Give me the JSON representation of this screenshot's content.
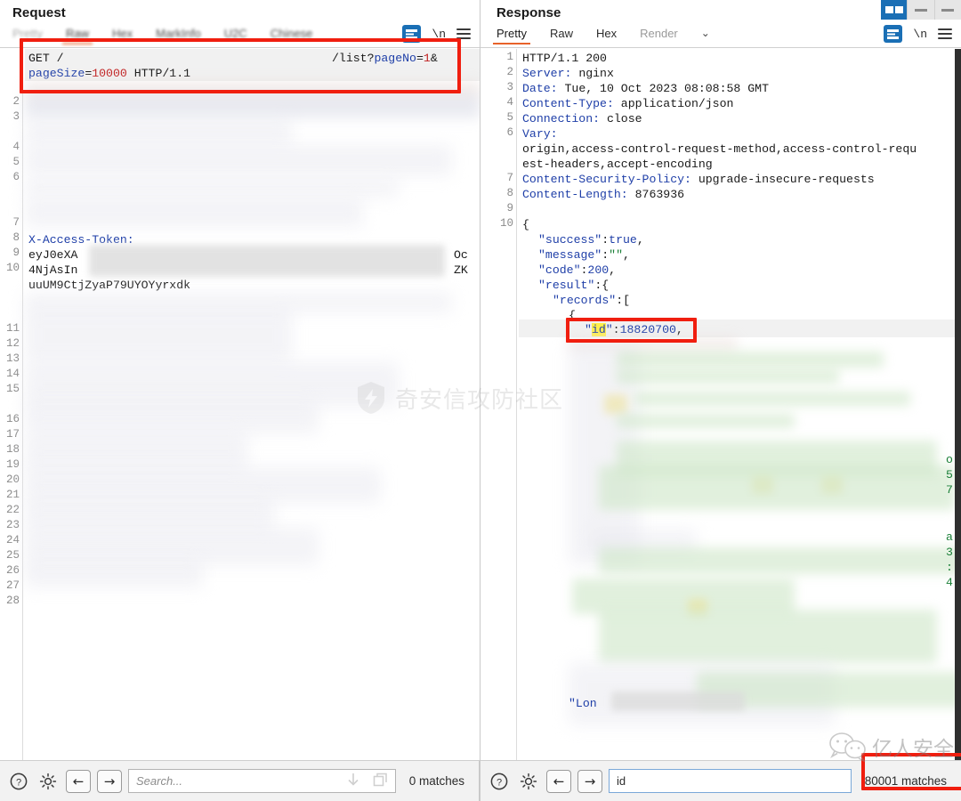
{
  "window": {
    "controls": [
      {
        "name": "restore",
        "state": "active"
      },
      {
        "name": "minimize",
        "state": "normal"
      },
      {
        "name": "maximize",
        "state": "normal"
      }
    ]
  },
  "watermarks": {
    "center": "奇安信攻防社区",
    "bottom_right": "亿人安全"
  },
  "request": {
    "title": "Request",
    "tabs": [
      {
        "label": "Pretty",
        "active": false,
        "muted": true
      },
      {
        "label": "Raw",
        "active": true,
        "muted": false
      },
      {
        "label": "Hex",
        "active": false,
        "muted": false
      },
      {
        "label": "MarkInfo",
        "active": false,
        "muted": false
      },
      {
        "label": "U2C",
        "active": false,
        "muted": false
      },
      {
        "label": "Chinese",
        "active": false,
        "muted": false
      }
    ],
    "chevron": "⌄",
    "newline_label": "\\n",
    "line_numbers": [
      "2",
      "3",
      "4",
      "5",
      "6",
      "7",
      "8",
      "9",
      "10",
      "11",
      "12",
      "13",
      "14",
      "15",
      "16",
      "17",
      "18",
      "19",
      "20",
      "21",
      "22",
      "23",
      "24",
      "25",
      "26",
      "27",
      "28"
    ],
    "code": {
      "method": "GET",
      "path_prefix": "/",
      "path_suffix": "/list?",
      "query_key_1": "pageNo",
      "query_val_1": "1",
      "amp": "&",
      "query_key_2": "pageSize",
      "query_val_2": "10000",
      "http_version": "HTTP/1.1",
      "token_header": "X-Access-Token:",
      "token_line_1": "eyJ0eXA",
      "token_line_1_tail": "Oc",
      "token_line_2": "4NjAsIn",
      "token_line_2_tail": "ZK",
      "token_line_3": "uuUM9CtjZyaP79UYOYyrxdk"
    },
    "toolbar": {
      "help_icon": "help-icon",
      "settings_icon": "gear-icon",
      "prev_label": "←",
      "next_label": "→",
      "search_value": "",
      "search_placeholder": "Search...",
      "matches": "0 matches"
    }
  },
  "response": {
    "title": "Response",
    "tabs": [
      {
        "label": "Pretty",
        "active": true,
        "muted": false
      },
      {
        "label": "Raw",
        "active": false,
        "muted": false
      },
      {
        "label": "Hex",
        "active": false,
        "muted": false
      },
      {
        "label": "Render",
        "active": false,
        "muted": true
      }
    ],
    "chevron": "⌄",
    "newline_label": "\\n",
    "line_numbers": [
      "1",
      "2",
      "3",
      "4",
      "5",
      "6",
      "7",
      "8",
      "9",
      "10"
    ],
    "headers": [
      {
        "n": "1",
        "name": "",
        "value": "HTTP/1.1 200"
      },
      {
        "n": "2",
        "name": "Server:",
        "value": " nginx"
      },
      {
        "n": "3",
        "name": "Date:",
        "value": " Tue, 10 Oct 2023 08:08:58 GMT"
      },
      {
        "n": "4",
        "name": "Content-Type:",
        "value": " application/json"
      },
      {
        "n": "5",
        "name": "Connection:",
        "value": " close"
      },
      {
        "n": "6",
        "name": "Vary:",
        "value": ""
      },
      {
        "n": "",
        "name": "",
        "value": "origin,access-control-request-method,access-control-requ"
      },
      {
        "n": "",
        "name": "",
        "value": "est-headers,accept-encoding"
      },
      {
        "n": "7",
        "name": "Content-Security-Policy:",
        "value": " upgrade-insecure-requests"
      },
      {
        "n": "8",
        "name": "Content-Length:",
        "value": " 8763936"
      },
      {
        "n": "9",
        "name": "",
        "value": ""
      },
      {
        "n": "10",
        "name": "",
        "value": "{"
      }
    ],
    "body": {
      "success_key": "\"success\"",
      "success_val": "true",
      "message_key": "\"message\"",
      "message_val": "\"\"",
      "code_key": "\"code\"",
      "code_val": "200",
      "result_key": "\"result\"",
      "records_key": "\"records\"",
      "brace": "{",
      "id_key_quote": "\"",
      "id_key": "id",
      "id_key_close": "\"",
      "id_val": "18820700",
      "comma": ",",
      "partial_tail": "\"Lon"
    },
    "edge_fragments": [
      "o",
      "5",
      "7",
      "a",
      "3",
      ":",
      "4"
    ],
    "toolbar": {
      "help_icon": "help-icon",
      "settings_icon": "gear-icon",
      "prev_label": "←",
      "next_label": "→",
      "search_value": "id",
      "search_placeholder": "",
      "matches": "80001 matches"
    }
  },
  "colors": {
    "accent_orange": "#e8622a",
    "annotation_red": "#f01e0f",
    "keyword_blue": "#1f3fa8",
    "number_red": "#c02020",
    "string_green": "#1a7f37",
    "highlight_yellow": "#ffef4a",
    "icon_blue": "#1a6fb5"
  }
}
